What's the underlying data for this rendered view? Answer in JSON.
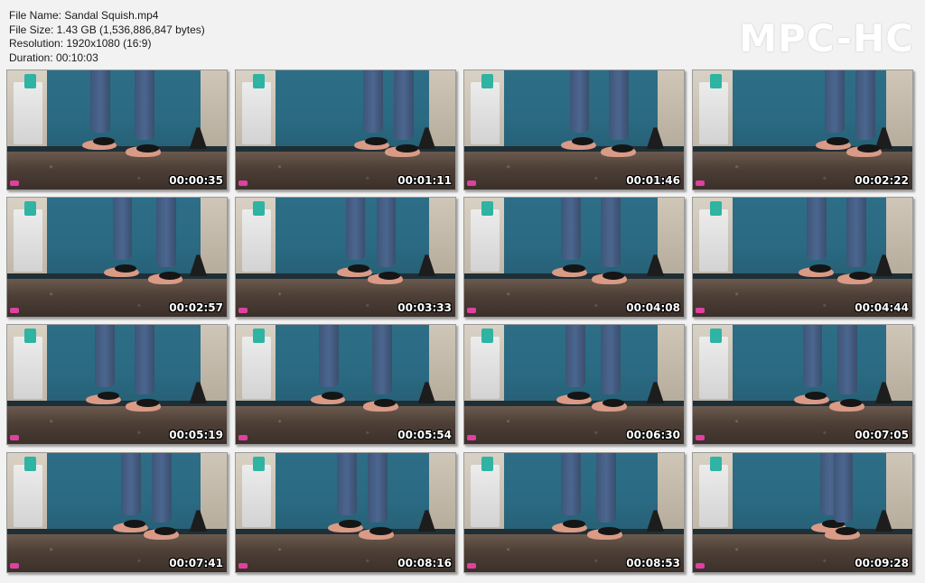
{
  "file_info": {
    "name_line": "File Name: Sandal Squish.mp4",
    "size_line": "File Size: 1.43 GB (1,536,886,847 bytes)",
    "resolution_line": "Resolution: 1920x1080 (16:9)",
    "duration_line": "Duration: 00:10:03"
  },
  "logo": "MPC-HC",
  "thumbnails": [
    {
      "timestamp": "00:00:35"
    },
    {
      "timestamp": "00:01:11"
    },
    {
      "timestamp": "00:01:46"
    },
    {
      "timestamp": "00:02:22"
    },
    {
      "timestamp": "00:02:57"
    },
    {
      "timestamp": "00:03:33"
    },
    {
      "timestamp": "00:04:08"
    },
    {
      "timestamp": "00:04:44"
    },
    {
      "timestamp": "00:05:19"
    },
    {
      "timestamp": "00:05:54"
    },
    {
      "timestamp": "00:06:30"
    },
    {
      "timestamp": "00:07:05"
    },
    {
      "timestamp": "00:07:41"
    },
    {
      "timestamp": "00:08:16"
    },
    {
      "timestamp": "00:08:53"
    },
    {
      "timestamp": "00:09:28"
    }
  ],
  "colors": {
    "background": "#f2f2f2",
    "wall": "#2d6e86",
    "floor": "#4d3f36",
    "jeans": "#4b6690"
  }
}
